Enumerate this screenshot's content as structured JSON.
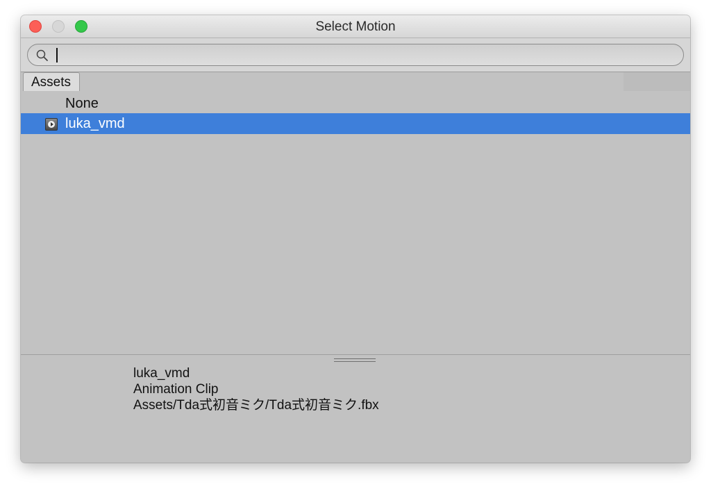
{
  "window": {
    "title": "Select Motion",
    "colors": {
      "close": "#fc5f57",
      "minimize": "#d7d7d7",
      "maximize": "#34c84a",
      "selection": "#3e7fda",
      "background": "#c2c2c2"
    }
  },
  "search": {
    "value": "",
    "placeholder": "",
    "icon": "search-icon"
  },
  "tabs": [
    {
      "label": "Assets",
      "active": true
    }
  ],
  "list": {
    "items": [
      {
        "label": "None",
        "selected": false,
        "icon": ""
      },
      {
        "label": "luka_vmd",
        "selected": true,
        "icon": "animation-clip-icon"
      }
    ]
  },
  "preview": {
    "name": "luka_vmd",
    "type": "Animation Clip",
    "path": "Assets/Tda式初音ミク/Tda式初音ミク.fbx"
  }
}
